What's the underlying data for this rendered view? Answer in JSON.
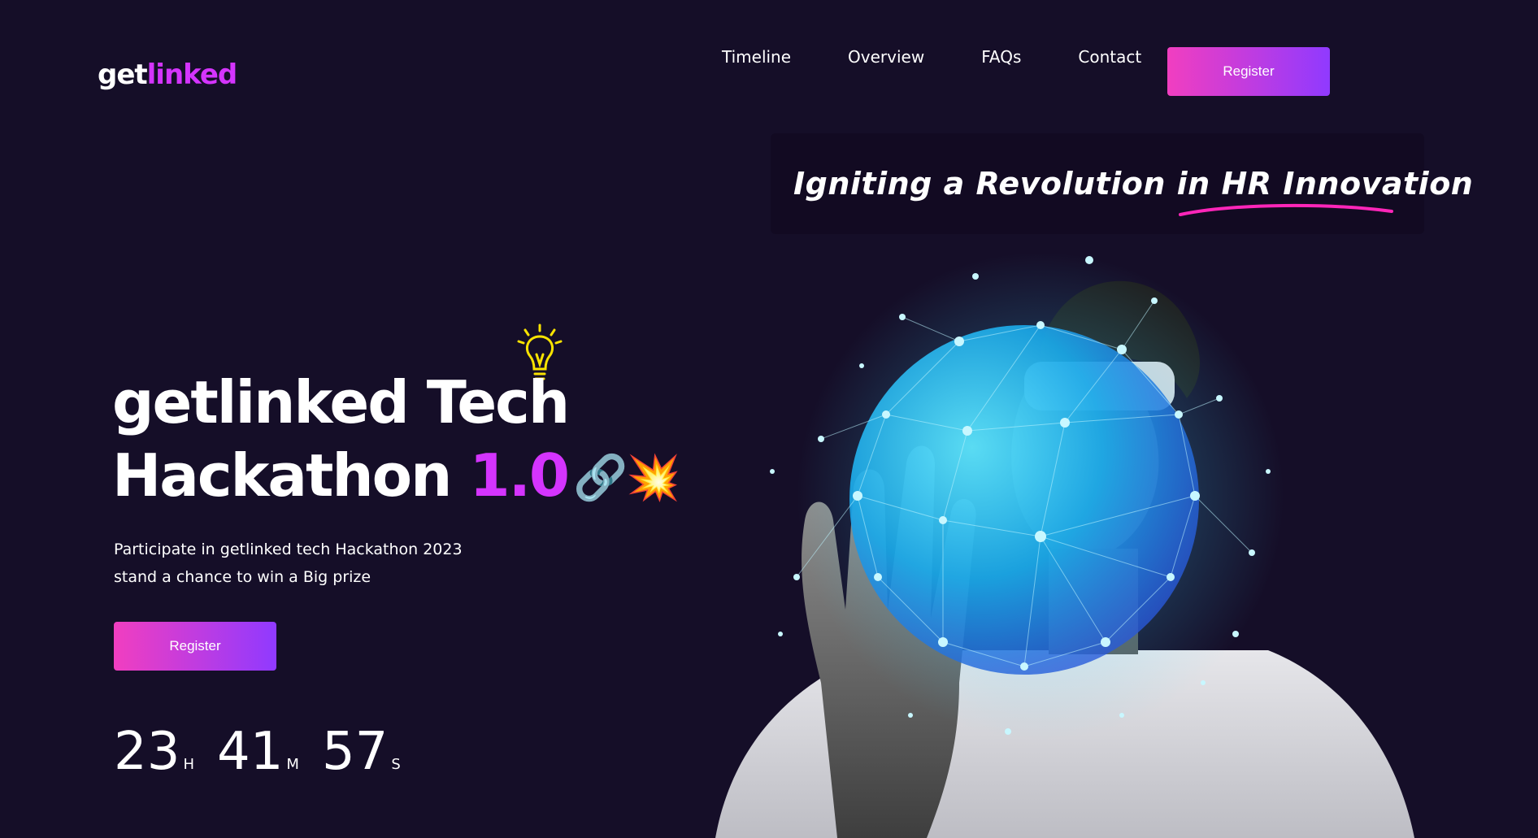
{
  "logo": {
    "part1": "get",
    "part2": "linked"
  },
  "nav": {
    "items": [
      {
        "label": "Timeline"
      },
      {
        "label": "Overview"
      },
      {
        "label": "FAQs"
      },
      {
        "label": "Contact"
      }
    ],
    "register_label": "Register"
  },
  "hero": {
    "tagline": "Igniting a Revolution in HR Innovation",
    "title_line1": "getlinked Tech",
    "title_line2": "Hackathon",
    "title_version": "1.0",
    "title_emoji": "🔗💥",
    "description": "Participate in getlinked tech Hackathon 2023 stand a chance to win a Big prize",
    "register_label": "Register",
    "countdown": {
      "hours": "23",
      "hours_unit": "H",
      "minutes": "41",
      "minutes_unit": "M",
      "seconds": "57",
      "seconds_unit": "S"
    }
  },
  "colors": {
    "background": "#150e28",
    "accent_purple": "#d434fe",
    "gradient_start": "#f13ec0",
    "gradient_end": "#903aff",
    "underline": "#ff26b9"
  },
  "icons": {
    "bulb": "lightbulb-icon",
    "chain": "chain-link-icon",
    "spark": "spark-icon"
  }
}
